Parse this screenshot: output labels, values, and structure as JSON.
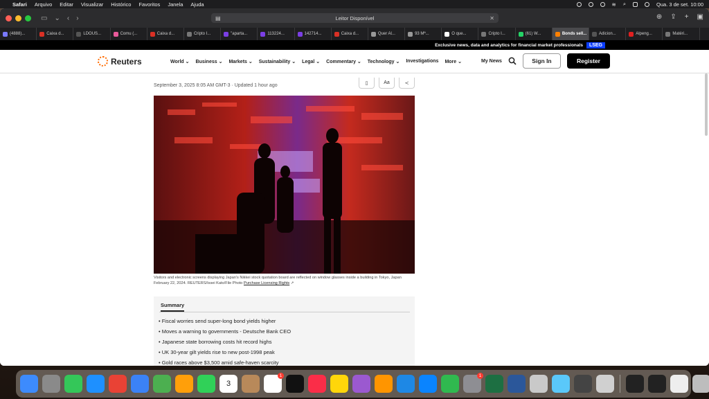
{
  "menubar": {
    "apple": "",
    "items": [
      "Safari",
      "Arquivo",
      "Editar",
      "Visualizar",
      "Histórico",
      "Favoritos",
      "Janela",
      "Ajuda"
    ],
    "clock": "Qua. 3 de set.  10:00"
  },
  "browser": {
    "address": "Leitor Disponível",
    "tabs": [
      {
        "label": "(4888)...",
        "color": "#7a7aff"
      },
      {
        "label": "Caixa d...",
        "color": "#d93025"
      },
      {
        "label": "LDOUS...",
        "color": "#555555"
      },
      {
        "label": "Comu (...",
        "color": "#e85a9a"
      },
      {
        "label": "Caixa d...",
        "color": "#d93025"
      },
      {
        "label": "Cripto I...",
        "color": "#777777"
      },
      {
        "label": "\"aparta...",
        "color": "#7b3fe4"
      },
      {
        "label": "113224...",
        "color": "#7b3fe4"
      },
      {
        "label": "142714...",
        "color": "#7b3fe4"
      },
      {
        "label": "Caixa d...",
        "color": "#d93025"
      },
      {
        "label": "Quer Al...",
        "color": "#999999"
      },
      {
        "label": "93 Mª...",
        "color": "#999999"
      },
      {
        "label": "O que...",
        "color": "#ffffff"
      },
      {
        "label": "Cripto I...",
        "color": "#777777"
      },
      {
        "label": "(61) W...",
        "color": "#25d366"
      },
      {
        "label": "Bonds sell...",
        "color": "#ff8000"
      },
      {
        "label": "Adicion...",
        "color": "#555555"
      },
      {
        "label": "Alpeng...",
        "color": "#e02020"
      },
      {
        "label": "Matéri...",
        "color": "#777777"
      }
    ],
    "active_tab_index": 15
  },
  "promo": {
    "text": "Exclusive news, data and analytics for financial market professionals",
    "badge": "LSEG"
  },
  "nav": {
    "logo": "Reuters",
    "items": [
      "World",
      "Business",
      "Markets",
      "Sustainability",
      "Legal",
      "Commentary",
      "Technology",
      "Investigations",
      "More"
    ],
    "my_news": "My News",
    "sign_in": "Sign In",
    "register": "Register"
  },
  "article": {
    "dateline": "September 3, 2025 8:05 AM GMT-3 · Updated 1 hour ago",
    "tools": [
      "bookmark-icon",
      "Aa",
      "share-icon"
    ],
    "caption": "Visitors and electronic screens displaying Japan's Nikkei stock quotation board are reflected on window glasses inside a building in Tokyo, Japan February 22, 2024. REUTERS/Issei Kato/File Photo",
    "caption_link": "Purchase Licensing Rights",
    "summary_title": "Summary",
    "summary": [
      "Fiscal worries send super-long bond yields higher",
      "Moves a warning to governments - Deutsche Bank CEO",
      "Japanese state borrowing costs hit record highs",
      "UK 30-year gilt yields rise to new post-1998 peak",
      "Gold races above $3,500 amid safe-haven scarcity"
    ]
  },
  "dock": {
    "apps": [
      {
        "name": "finder-icon",
        "color": "#3d8bfd"
      },
      {
        "name": "launchpad-icon",
        "color": "#8a8a8a"
      },
      {
        "name": "messages-icon",
        "color": "#34c759"
      },
      {
        "name": "safari-icon",
        "color": "#1e90ff"
      },
      {
        "name": "chrome-icon",
        "color": "#e94235"
      },
      {
        "name": "mail-icon",
        "color": "#3b82f6"
      },
      {
        "name": "maps-icon",
        "color": "#4caf50"
      },
      {
        "name": "photos-icon",
        "color": "#ff9f0a"
      },
      {
        "name": "facetime-icon",
        "color": "#30d158"
      },
      {
        "name": "calendar-icon",
        "color": "#ffffff",
        "text": "3"
      },
      {
        "name": "contacts-icon",
        "color": "#b8895a"
      },
      {
        "name": "reminders-icon",
        "color": "#ffffff",
        "badge": "1"
      },
      {
        "name": "tv-icon",
        "color": "#111111"
      },
      {
        "name": "music-icon",
        "color": "#fa2d48"
      },
      {
        "name": "notes-icon",
        "color": "#ffd60a"
      },
      {
        "name": "podcasts-icon",
        "color": "#9b59d0"
      },
      {
        "name": "pages-icon",
        "color": "#ff9500"
      },
      {
        "name": "keynote-icon",
        "color": "#1e88e5"
      },
      {
        "name": "app-store-icon",
        "color": "#0a84ff"
      },
      {
        "name": "numbers-icon",
        "color": "#30b94f"
      },
      {
        "name": "system-settings-icon",
        "color": "#8e8e93",
        "badge": "1"
      },
      {
        "name": "excel-icon",
        "color": "#1d6f42"
      },
      {
        "name": "word-icon",
        "color": "#2b579a"
      },
      {
        "name": "powerpoint-icon",
        "color": "#c9c9c9"
      },
      {
        "name": "preview-icon",
        "color": "#5ac8fa"
      },
      {
        "name": "calculator-icon",
        "color": "#444444"
      },
      {
        "name": "screen-capture-icon",
        "color": "#d0d0d0"
      },
      {
        "name": "window-thumb-1",
        "color": "#222222"
      },
      {
        "name": "window-thumb-2",
        "color": "#222222"
      },
      {
        "name": "window-thumb-3",
        "color": "#eeeeee"
      },
      {
        "name": "trash-icon",
        "color": "#bdbdbd"
      }
    ]
  }
}
